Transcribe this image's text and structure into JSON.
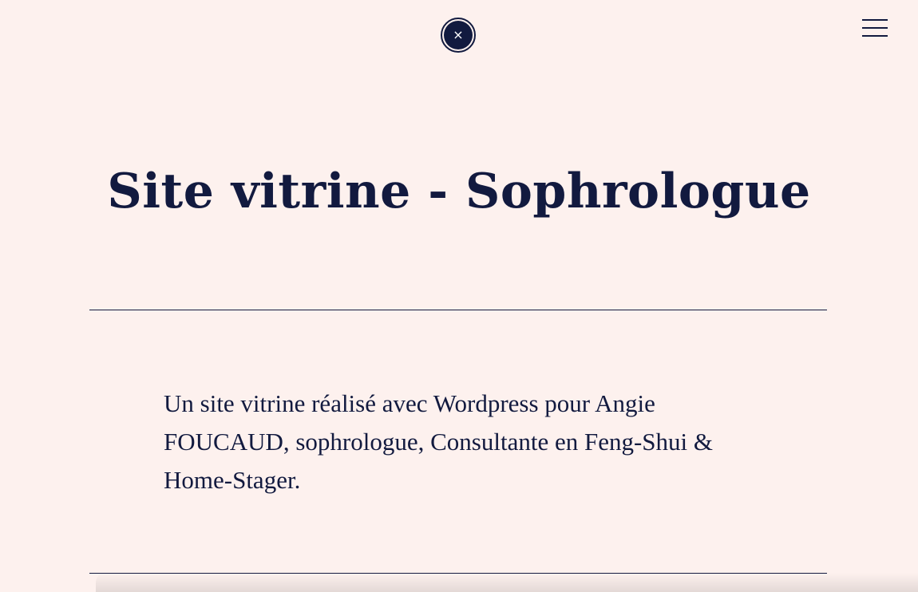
{
  "header": {
    "close_symbol": "×",
    "close_icon": "close-icon",
    "menu_icon": "hamburger-menu-icon"
  },
  "project": {
    "title": "Site vitrine - Sophrologue",
    "description": "Un site vitrine réalisé avec Wordpress pour Angie FOUCAUD, sophrologue, Consultante en Feng-Shui & Home-Stager."
  },
  "colors": {
    "background": "#fdf1ee",
    "text": "#121a3f",
    "accent": "#121a3f"
  }
}
